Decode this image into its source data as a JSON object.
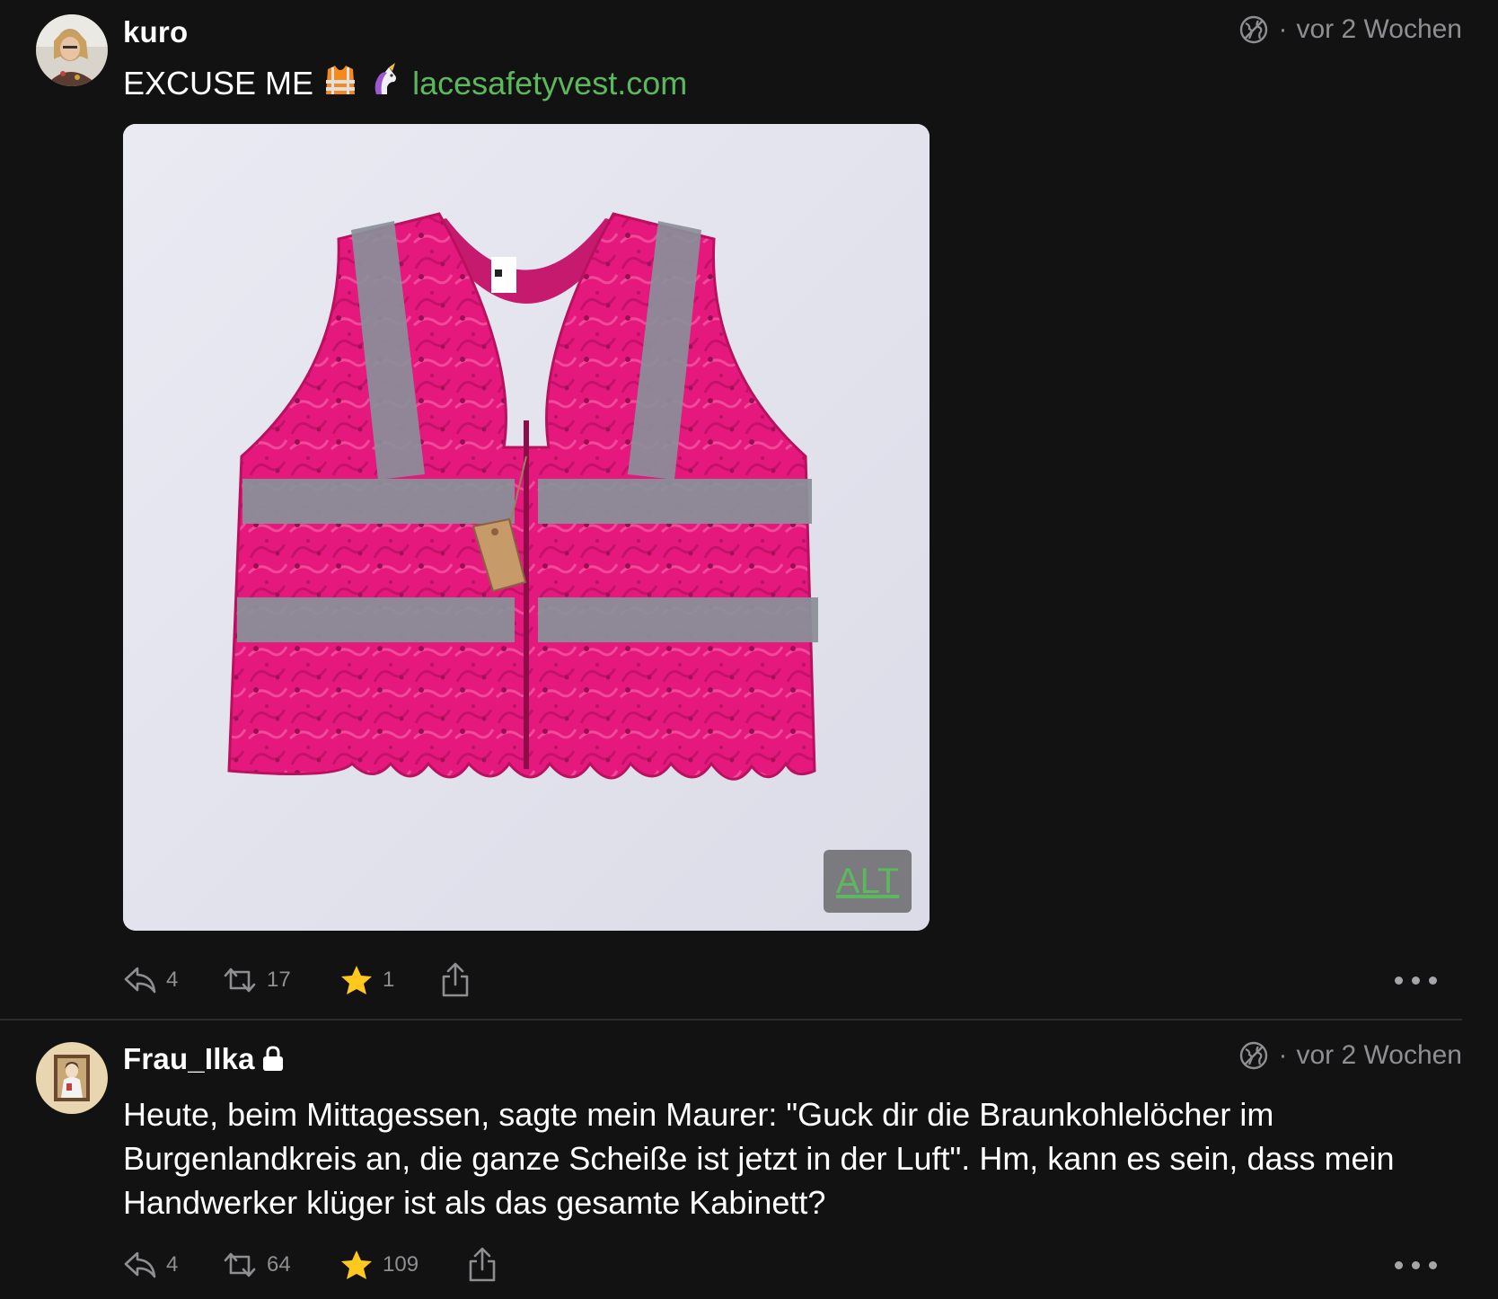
{
  "posts": [
    {
      "username": "kuro",
      "timestamp": "vor 2 Wochen",
      "separator": "·",
      "visibility_icon": "globe-icon",
      "text": "EXCUSE ME",
      "emojis": [
        "safety-vest-emoji",
        "unicorn-emoji"
      ],
      "link": "lacesafetyvest.com",
      "media": {
        "alt_label": "ALT"
      },
      "stats": {
        "replies": "4",
        "boosts": "17",
        "favourites": "1"
      }
    },
    {
      "username": "Frau_Ilka",
      "locked": true,
      "timestamp": "vor 2 Wochen",
      "separator": "·",
      "visibility_icon": "globe-icon",
      "text": "Heute, beim Mittagessen, sagte mein Maurer: \"Guck dir die Braunkohlelöcher im Burgenlandkreis an, die ganze Scheiße ist jetzt in der Luft\". Hm, kann es sein, dass mein Handwerker klüger ist als das gesamte Kabinett?",
      "stats": {
        "replies": "4",
        "boosts": "64",
        "favourites": "109"
      }
    }
  ],
  "colors": {
    "background": "#121212",
    "link": "#5cb85c",
    "muted": "#8e8e93",
    "star": "#ffc81e",
    "vest": "#e5197d"
  }
}
